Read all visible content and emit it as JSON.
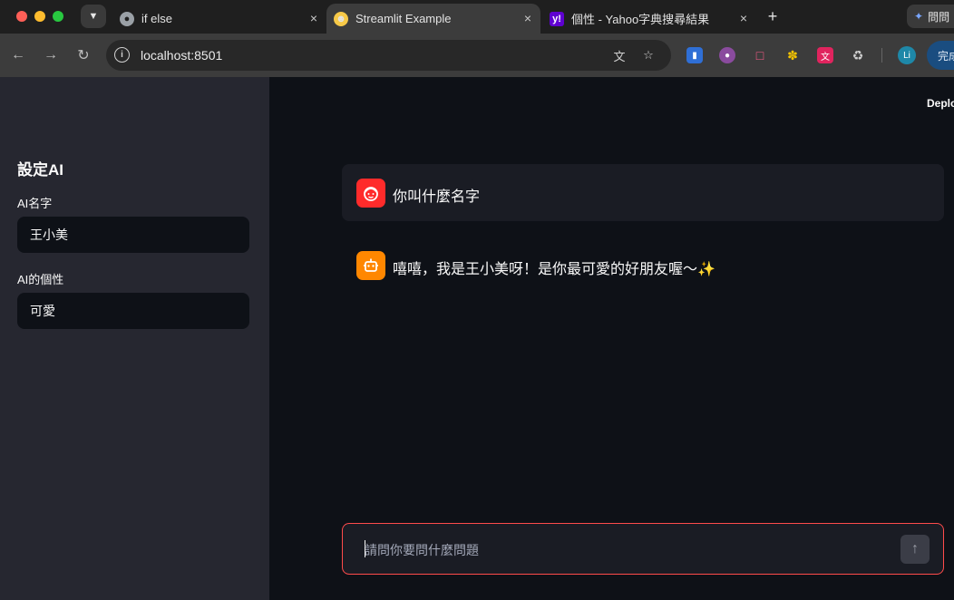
{
  "browser": {
    "tabs": [
      {
        "title": "if else",
        "favicon": "globe-icon",
        "active": false
      },
      {
        "title": "Streamlit Example",
        "favicon": "grinning-emoji-icon",
        "active": true
      },
      {
        "title": "個性 - Yahoo字典搜尋結果",
        "favicon": "yahoo-icon",
        "favicon_text": "y!",
        "active": false
      }
    ],
    "close_glyph": "×",
    "new_tab_glyph": "+",
    "gemini_label": "問問",
    "address": "localhost:8501",
    "profile_initials": "Li",
    "finish_label": "完成"
  },
  "sidebar": {
    "title": "設定AI",
    "name_label": "AI名字",
    "name_value": "王小美",
    "personality_label": "AI的個性",
    "personality_value": "可愛"
  },
  "main": {
    "deploy_label": "Deploy",
    "messages": [
      {
        "role": "user",
        "avatar": "user-face-icon",
        "text": "你叫什麼名字"
      },
      {
        "role": "assistant",
        "avatar": "robot-icon",
        "text": "嘻嘻，我是王小美呀！是你最可愛的好朋友喔～✨"
      }
    ],
    "chat_input": {
      "placeholder": "請問你要問什麼問題"
    }
  },
  "colors": {
    "accent": "#ff4b4b",
    "user_avatar": "#ff2b2b",
    "assistant_avatar": "#ff8700",
    "sidebar_bg": "#262730",
    "main_bg": "#0e1117"
  }
}
